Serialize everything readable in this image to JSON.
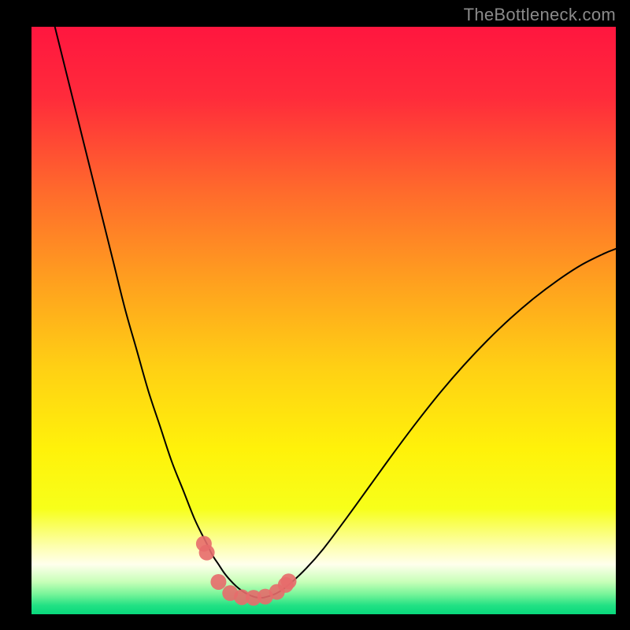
{
  "watermark": "TheBottleneck.com",
  "chart_data": {
    "type": "line",
    "title": "",
    "xlabel": "",
    "ylabel": "",
    "xlim": [
      0,
      100
    ],
    "ylim": [
      0,
      100
    ],
    "grid": false,
    "legend": false,
    "background_gradient_stops": [
      {
        "offset": 0.0,
        "color": "#ff163f"
      },
      {
        "offset": 0.12,
        "color": "#ff2b3b"
      },
      {
        "offset": 0.28,
        "color": "#ff6a2c"
      },
      {
        "offset": 0.44,
        "color": "#ffa21e"
      },
      {
        "offset": 0.58,
        "color": "#ffd014"
      },
      {
        "offset": 0.72,
        "color": "#fff20a"
      },
      {
        "offset": 0.82,
        "color": "#f7ff1a"
      },
      {
        "offset": 0.885,
        "color": "#fdffb0"
      },
      {
        "offset": 0.915,
        "color": "#ffffec"
      },
      {
        "offset": 0.945,
        "color": "#c7ffb8"
      },
      {
        "offset": 0.965,
        "color": "#7bf59a"
      },
      {
        "offset": 0.985,
        "color": "#22e184"
      },
      {
        "offset": 1.0,
        "color": "#08d87c"
      }
    ],
    "series": [
      {
        "name": "bottleneck-curve",
        "color": "#000000",
        "stroke_width": 2,
        "x": [
          4,
          6,
          8,
          10,
          12,
          14,
          16,
          18,
          20,
          22,
          24,
          26,
          28,
          30,
          31,
          32,
          33,
          34,
          35,
          36,
          37,
          38,
          39,
          40,
          42,
          44,
          47,
          50,
          54,
          58,
          62,
          66,
          70,
          74,
          78,
          82,
          86,
          90,
          94,
          98,
          100
        ],
        "y": [
          100,
          92,
          84,
          76,
          68,
          60,
          52,
          45,
          38,
          32,
          26,
          21,
          16,
          12,
          10,
          8.5,
          7,
          5.8,
          4.8,
          4,
          3.4,
          3.0,
          2.8,
          2.9,
          3.6,
          5.0,
          7.8,
          11.2,
          16.5,
          22,
          27.5,
          32.8,
          37.8,
          42.4,
          46.6,
          50.4,
          53.8,
          56.8,
          59.4,
          61.4,
          62.2
        ]
      },
      {
        "name": "bottom-markers",
        "type": "scatter",
        "color": "#e76b6b",
        "marker_radius": 10,
        "x": [
          29.5,
          30.0,
          32.0,
          34.0,
          36.0,
          38.0,
          40.0,
          42.0,
          43.5,
          44.0
        ],
        "y": [
          12.0,
          10.5,
          5.5,
          3.6,
          2.9,
          2.8,
          3.0,
          3.8,
          5.0,
          5.6
        ]
      }
    ]
  }
}
